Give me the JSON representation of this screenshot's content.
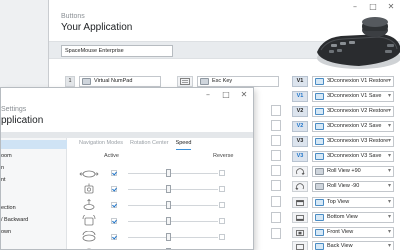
{
  "back_window": {
    "eyebrow": "Buttons",
    "title": "Your Application",
    "device_select": "SpaceMouse Enterprise",
    "chrome": {
      "minimize": "–",
      "maximize": "□",
      "close": "✕"
    }
  },
  "button_rows": [
    {
      "number": "1",
      "function": "Virtual NumPad",
      "key_icon": "keyboard-icon",
      "key_function": "Esc Key",
      "v_label": "V1",
      "v_function": "3Dconnexion V1 Restore"
    },
    {
      "v_label": "V1",
      "v_function": "3Dconnexion V1 Save"
    },
    {
      "v_label": "V2",
      "v_function": "3Dconnexion V2 Restore"
    },
    {
      "v_label": "V2",
      "v_function": "3Dconnexion V2 Save"
    },
    {
      "v_label": "V3",
      "v_function": "3Dconnexion V3 Restore"
    },
    {
      "v_label": "V3",
      "v_function": "3Dconnexion V3 Save"
    }
  ],
  "view_rows": [
    {
      "icon": "roll-view-icon",
      "function": "Roll View +90"
    },
    {
      "icon": "roll-view-icon",
      "function": "Roll View -90"
    },
    {
      "icon": "top-view-icon",
      "function": "Top View"
    },
    {
      "icon": "bottom-view-icon",
      "function": "Bottom View"
    },
    {
      "icon": "front-view-icon",
      "function": "Front View"
    },
    {
      "icon": "back-view-icon",
      "function": "Back View"
    }
  ],
  "front_window": {
    "eyebrow": "Settings",
    "title": "pplication",
    "chrome": {
      "minimize": "–",
      "maximize": "□",
      "close": "✕"
    },
    "left_pane": [
      {
        "label": "",
        "selected": true
      },
      {
        "label": "oom"
      },
      {
        "label": "n"
      },
      {
        "label": "nt"
      },
      {
        "label": ""
      },
      {
        "label": "ection"
      },
      {
        "label": "/ Backward"
      },
      {
        "label": "own"
      }
    ],
    "tabs": [
      "Navigation Modes",
      "Rotation Center",
      "Speed"
    ],
    "active_tab": "Speed",
    "columns": {
      "active": "Active",
      "reverse": "Reverse"
    },
    "axes": [
      {
        "icon": "pan-right-left-icon",
        "active": true,
        "speed": 0.5,
        "reverse": false
      },
      {
        "icon": "zoom-icon",
        "active": true,
        "speed": 0.5,
        "reverse": false
      },
      {
        "icon": "pan-up-down-icon",
        "active": true,
        "speed": 0.5,
        "reverse": false
      },
      {
        "icon": "tilt-icon",
        "active": true,
        "speed": 0.5,
        "reverse": false
      },
      {
        "icon": "spin-icon",
        "active": true,
        "speed": 0.5,
        "reverse": false
      },
      {
        "icon": "roll-icon",
        "active": true,
        "speed": 0.5,
        "reverse": false
      }
    ]
  },
  "colors": {
    "accent": "#1d73c9",
    "selection": "#cfe3f5",
    "panel": "#e8ebee"
  }
}
